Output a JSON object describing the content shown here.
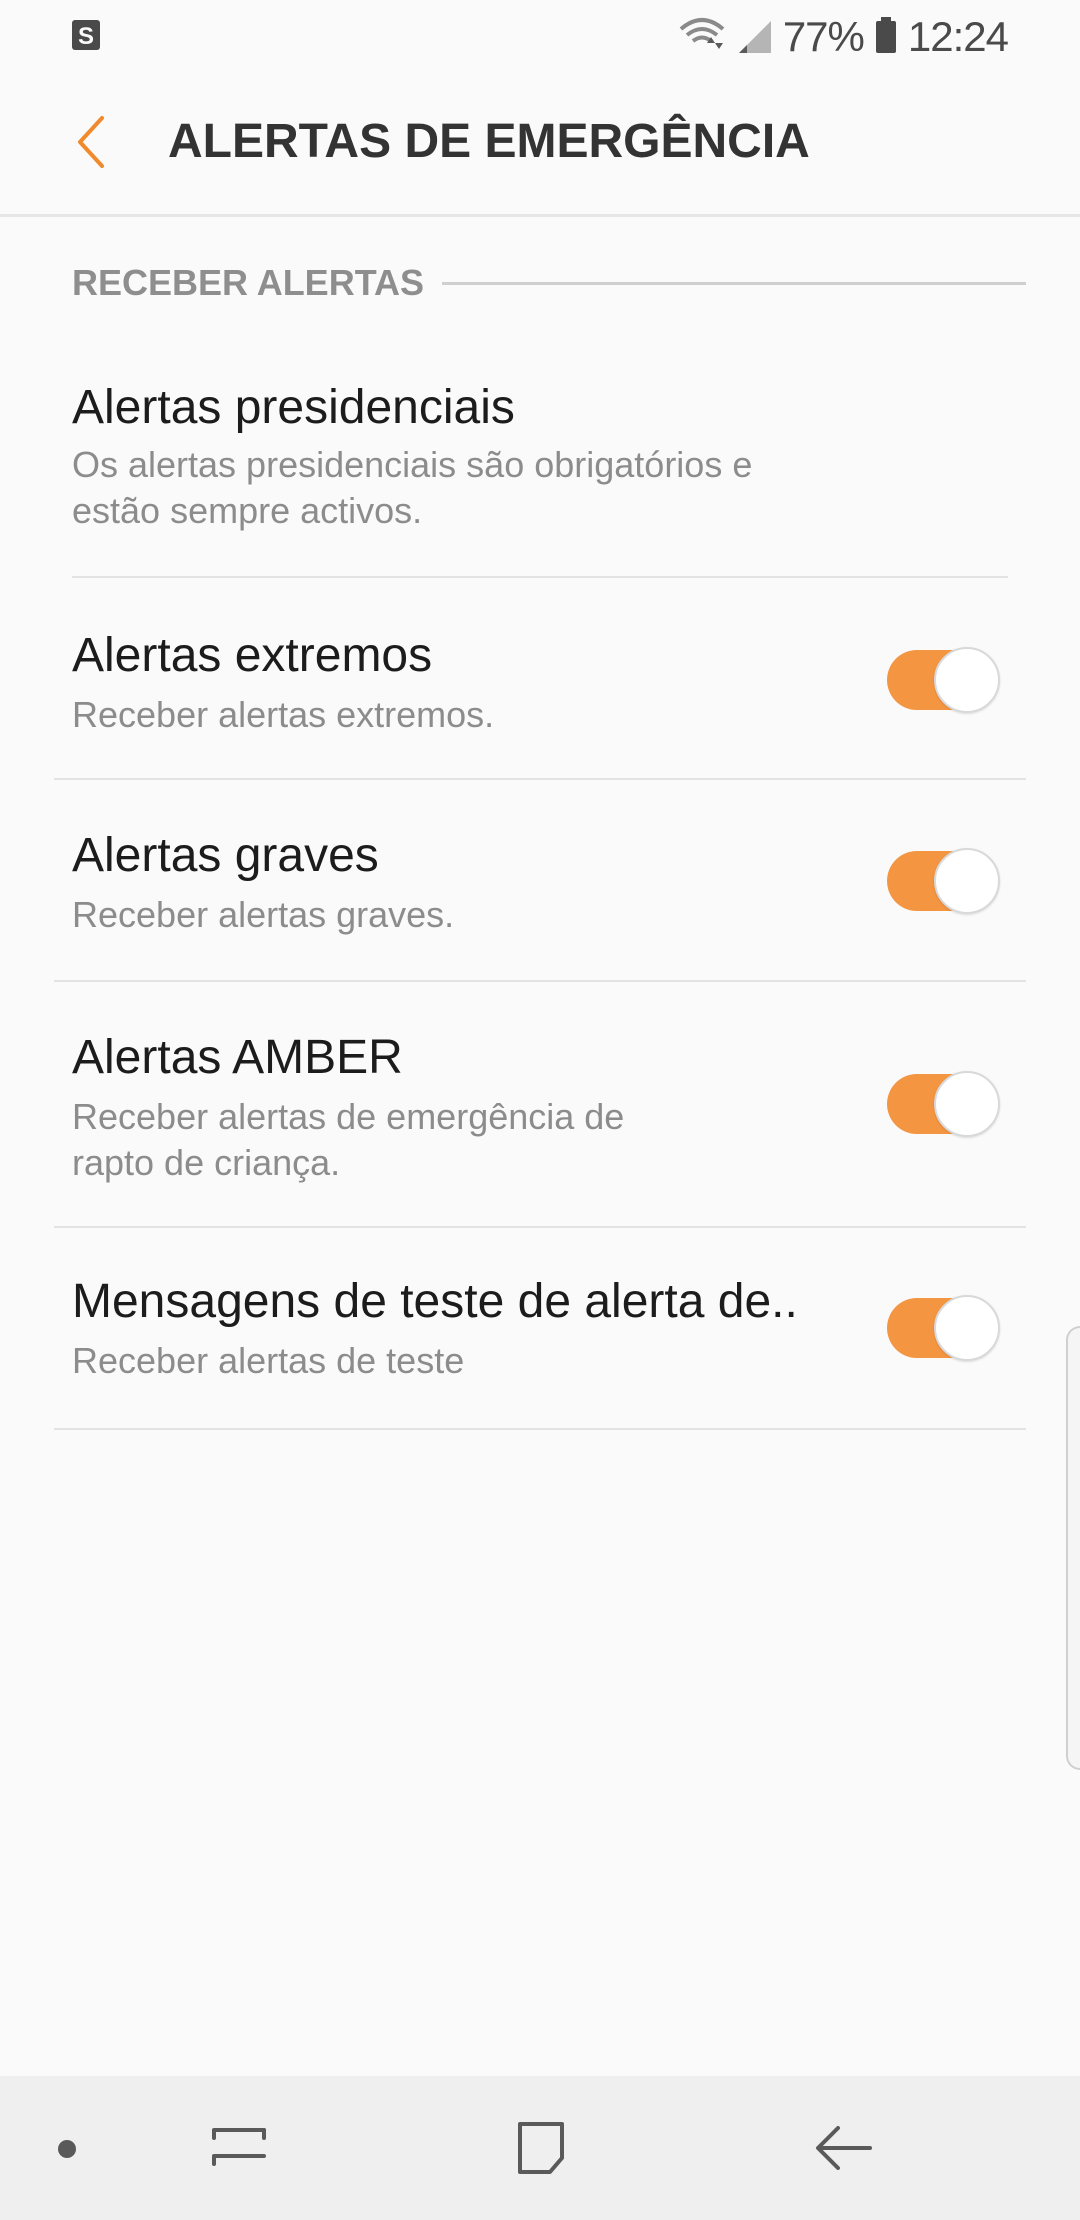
{
  "status_bar": {
    "left_icon": "s-notification-icon",
    "wifi_icon": "wifi-icon",
    "signal_icon": "signal-icon",
    "battery_percent": "77%",
    "battery_icon": "battery-icon",
    "time": "12:24"
  },
  "app_bar": {
    "back_icon": "chevron-left-icon",
    "title": "ALERTAS DE EMERGÊNCIA"
  },
  "section": {
    "title": "RECEBER ALERTAS"
  },
  "items": [
    {
      "title": "Alertas presidenciais",
      "subtitle_line1": "Os alertas presidenciais são obrigatórios e",
      "subtitle_line2": "estão sempre activos.",
      "has_toggle": false
    },
    {
      "title": "Alertas extremos",
      "subtitle_line1": "Receber alertas extremos.",
      "has_toggle": true,
      "toggle_on": true
    },
    {
      "title": "Alertas graves",
      "subtitle_line1": "Receber alertas graves.",
      "has_toggle": true,
      "toggle_on": true
    },
    {
      "title": "Alertas AMBER",
      "subtitle_line1": "Receber alertas de emergência de",
      "subtitle_line2": "rapto de criança.",
      "has_toggle": true,
      "toggle_on": true
    },
    {
      "title": "Mensagens de teste de alerta de..",
      "subtitle_line1": "Receber alertas de teste",
      "has_toggle": true,
      "toggle_on": true
    }
  ],
  "nav_bar": {
    "dot_icon": "nav-dot-icon",
    "recents_icon": "recents-icon",
    "home_icon": "home-icon",
    "back_icon": "back-arrow-icon"
  },
  "colors": {
    "accent": "#f49541",
    "background": "#fafafa",
    "nav_background": "#efefef"
  }
}
